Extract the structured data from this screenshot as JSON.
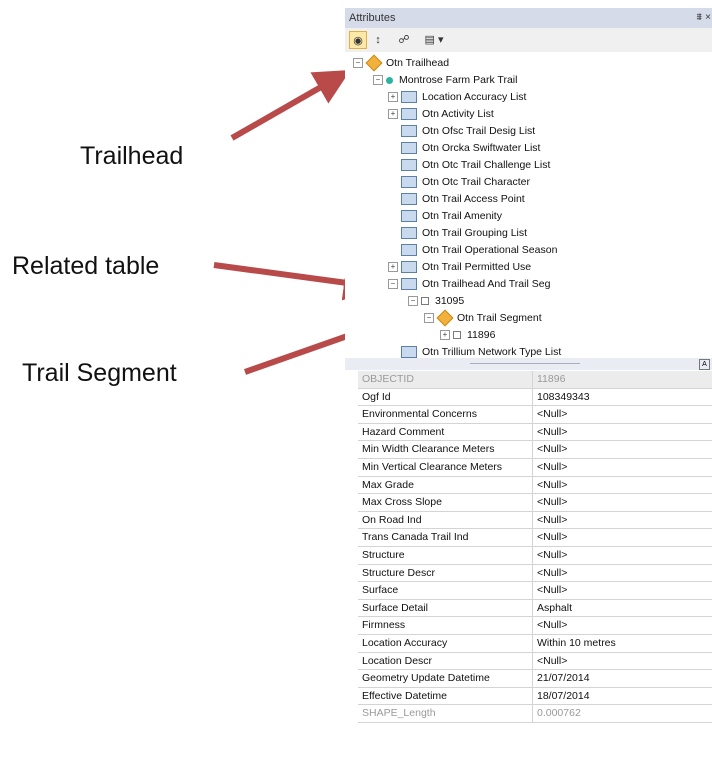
{
  "callouts": {
    "trailhead": "Trailhead",
    "related_table": "Related table",
    "trail_segment": "Trail Segment"
  },
  "colors": {
    "arrow": "#b84a4a",
    "panel_header": "#d6dbe9",
    "active_tool": "#fde8a8"
  },
  "panel": {
    "title": "Attributes",
    "pin_icon": "⩩",
    "close_icon": "×",
    "toolbar": [
      "show-features-icon",
      "sort-icon",
      "identify-icon",
      "options-icon"
    ]
  },
  "tree": {
    "root": "Otn Trailhead",
    "trail": "Montrose Farm Park Trail",
    "tables": [
      "Location Accuracy List",
      "Otn Activity List",
      "Otn Ofsc Trail Desig List",
      "Otn Orcka Swiftwater List",
      "Otn Otc Trail Challenge List",
      "Otn Otc Trail Character",
      "Otn Trail Access Point",
      "Otn Trail Amenity",
      "Otn Trail Grouping List",
      "Otn Trail Operational Season",
      "Otn Trail Permitted Use",
      "Otn Trailhead And Trail Seg"
    ],
    "record": "31095",
    "segment": "Otn Trail Segment",
    "segment_record": "11896",
    "last_table": "Otn Trillium Network Type List"
  },
  "attributes": [
    {
      "name": "OBJECTID",
      "value": "11896"
    },
    {
      "name": "Ogf Id",
      "value": "108349343"
    },
    {
      "name": "Environmental Concerns",
      "value": "<Null>"
    },
    {
      "name": "Hazard Comment",
      "value": "<Null>"
    },
    {
      "name": "Min Width Clearance Meters",
      "value": "<Null>"
    },
    {
      "name": "Min Vertical Clearance Meters",
      "value": "<Null>"
    },
    {
      "name": "Max Grade",
      "value": "<Null>"
    },
    {
      "name": "Max Cross Slope",
      "value": "<Null>"
    },
    {
      "name": "On Road Ind",
      "value": "<Null>"
    },
    {
      "name": "Trans Canada Trail Ind",
      "value": "<Null>"
    },
    {
      "name": "Structure",
      "value": "<Null>"
    },
    {
      "name": "Structure Descr",
      "value": "<Null>"
    },
    {
      "name": "Surface",
      "value": "<Null>"
    },
    {
      "name": "Surface Detail",
      "value": "Asphalt"
    },
    {
      "name": "Firmness",
      "value": "<Null>"
    },
    {
      "name": "Location Accuracy",
      "value": "Within 10 metres"
    },
    {
      "name": "Location Descr",
      "value": "<Null>"
    },
    {
      "name": "Geometry Update Datetime",
      "value": "21/07/2014"
    },
    {
      "name": "Effective Datetime",
      "value": "18/07/2014"
    },
    {
      "name": "SHAPE_Length",
      "value": "0.000762"
    }
  ]
}
